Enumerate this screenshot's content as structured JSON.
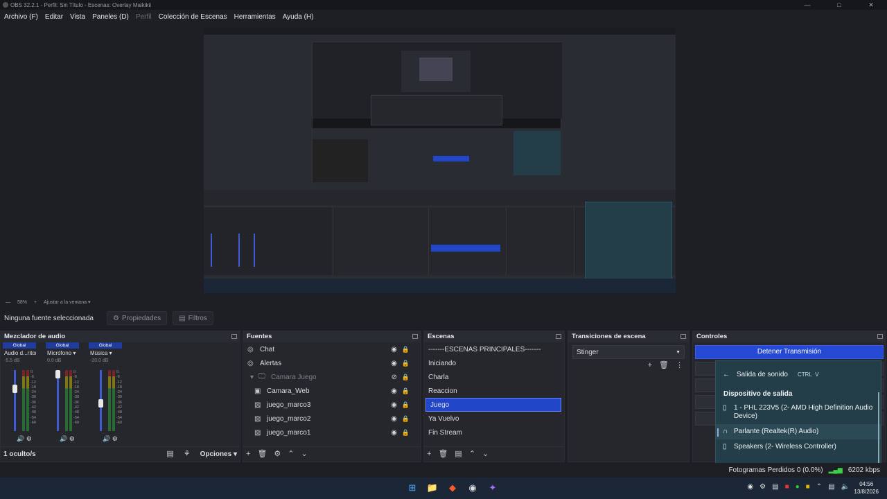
{
  "window": {
    "title": "OBS 32.2.1 - Perfil: Sin Título - Escenas: Overlay Maikikii"
  },
  "menu": [
    {
      "label": "Archivo (F)",
      "enabled": true
    },
    {
      "label": "Editar",
      "enabled": true
    },
    {
      "label": "Vista",
      "enabled": true
    },
    {
      "label": "Paneles (D)",
      "enabled": true
    },
    {
      "label": "Perfil",
      "enabled": false
    },
    {
      "label": "Colección de Escenas",
      "enabled": true
    },
    {
      "label": "Herramientas",
      "enabled": true
    },
    {
      "label": "Ayuda (H)",
      "enabled": true
    }
  ],
  "zoom": {
    "value": "58%",
    "fit_label": "Ajustar a la ventana"
  },
  "context": {
    "source_label": "Ninguna fuente seleccionada",
    "properties_label": "Propiedades",
    "filters_label": "Filtros"
  },
  "mixer": {
    "title": "Mezclador de audio",
    "channels": [
      {
        "badge": "Global",
        "name": "Audio d...ritorio",
        "db": "-5.5 dB",
        "level": 0.72
      },
      {
        "badge": "Global",
        "name": "Micrófono",
        "db": "0.0 dB",
        "level": 1.0
      },
      {
        "badge": "Global",
        "name": "Música",
        "db": "-20.0 dB",
        "level": 0.45
      }
    ],
    "scale": [
      "0",
      "-6",
      "-12",
      "-18",
      "-24",
      "-30",
      "-36",
      "-42",
      "-48",
      "-54",
      "-60"
    ],
    "footer_label": "1 oculto/s",
    "options_label": "Opciones"
  },
  "sources": {
    "title": "Fuentes",
    "items": [
      {
        "name": "Chat",
        "icon": "globe-icon",
        "indent": 0,
        "hidden": false
      },
      {
        "name": "Alertas",
        "icon": "globe-icon",
        "indent": 0,
        "hidden": false
      },
      {
        "name": "Camara Juego",
        "icon": "folder-icon",
        "indent": 0,
        "hidden": true,
        "group": true
      },
      {
        "name": "Camara_Web",
        "icon": "camera-icon",
        "indent": 1,
        "hidden": false
      },
      {
        "name": "juego_marco3",
        "icon": "image-icon",
        "indent": 1,
        "hidden": false
      },
      {
        "name": "juego_marco2",
        "icon": "image-icon",
        "indent": 1,
        "hidden": false
      },
      {
        "name": "juego_marco1",
        "icon": "image-icon",
        "indent": 1,
        "hidden": false
      }
    ]
  },
  "scenes": {
    "title": "Escenas",
    "items": [
      "-------ESCENAS PRINCIPALES-------",
      "Iniciando",
      "Charla",
      "Reaccion",
      "Juego",
      "Ya Vuelvo",
      "Fin Stream"
    ],
    "selected": 4
  },
  "transitions": {
    "title": "Transiciones de escena",
    "current": "Stinger"
  },
  "controls": {
    "title": "Controles",
    "stop_stream_label": "Detener Transmisión"
  },
  "audio_flyout": {
    "title": "Salida de sonido",
    "shortcut": "CTRL",
    "shortcut_key": "V",
    "section": "Dispositivo de salida",
    "devices": [
      {
        "name": "1 - PHL 223V5 (2- AMD High Definition Audio Device)",
        "icon": "monitor-icon",
        "active": false
      },
      {
        "name": "Parlante (Realtek(R) Audio)",
        "icon": "headphones-icon",
        "active": true
      },
      {
        "name": "Speakers (2- Wireless Controller)",
        "icon": "speaker-icon",
        "active": false
      }
    ]
  },
  "status": {
    "dropped_frames": "Fotogramas Perdidos 0 (0.0%)",
    "bitrate": "6202 kbps"
  },
  "clock": {
    "time": "04:56",
    "date": "13/8/2026"
  },
  "colors": {
    "accent": "#2649d4",
    "selection": "#2146c7",
    "flyout_bg": "#233e48"
  }
}
